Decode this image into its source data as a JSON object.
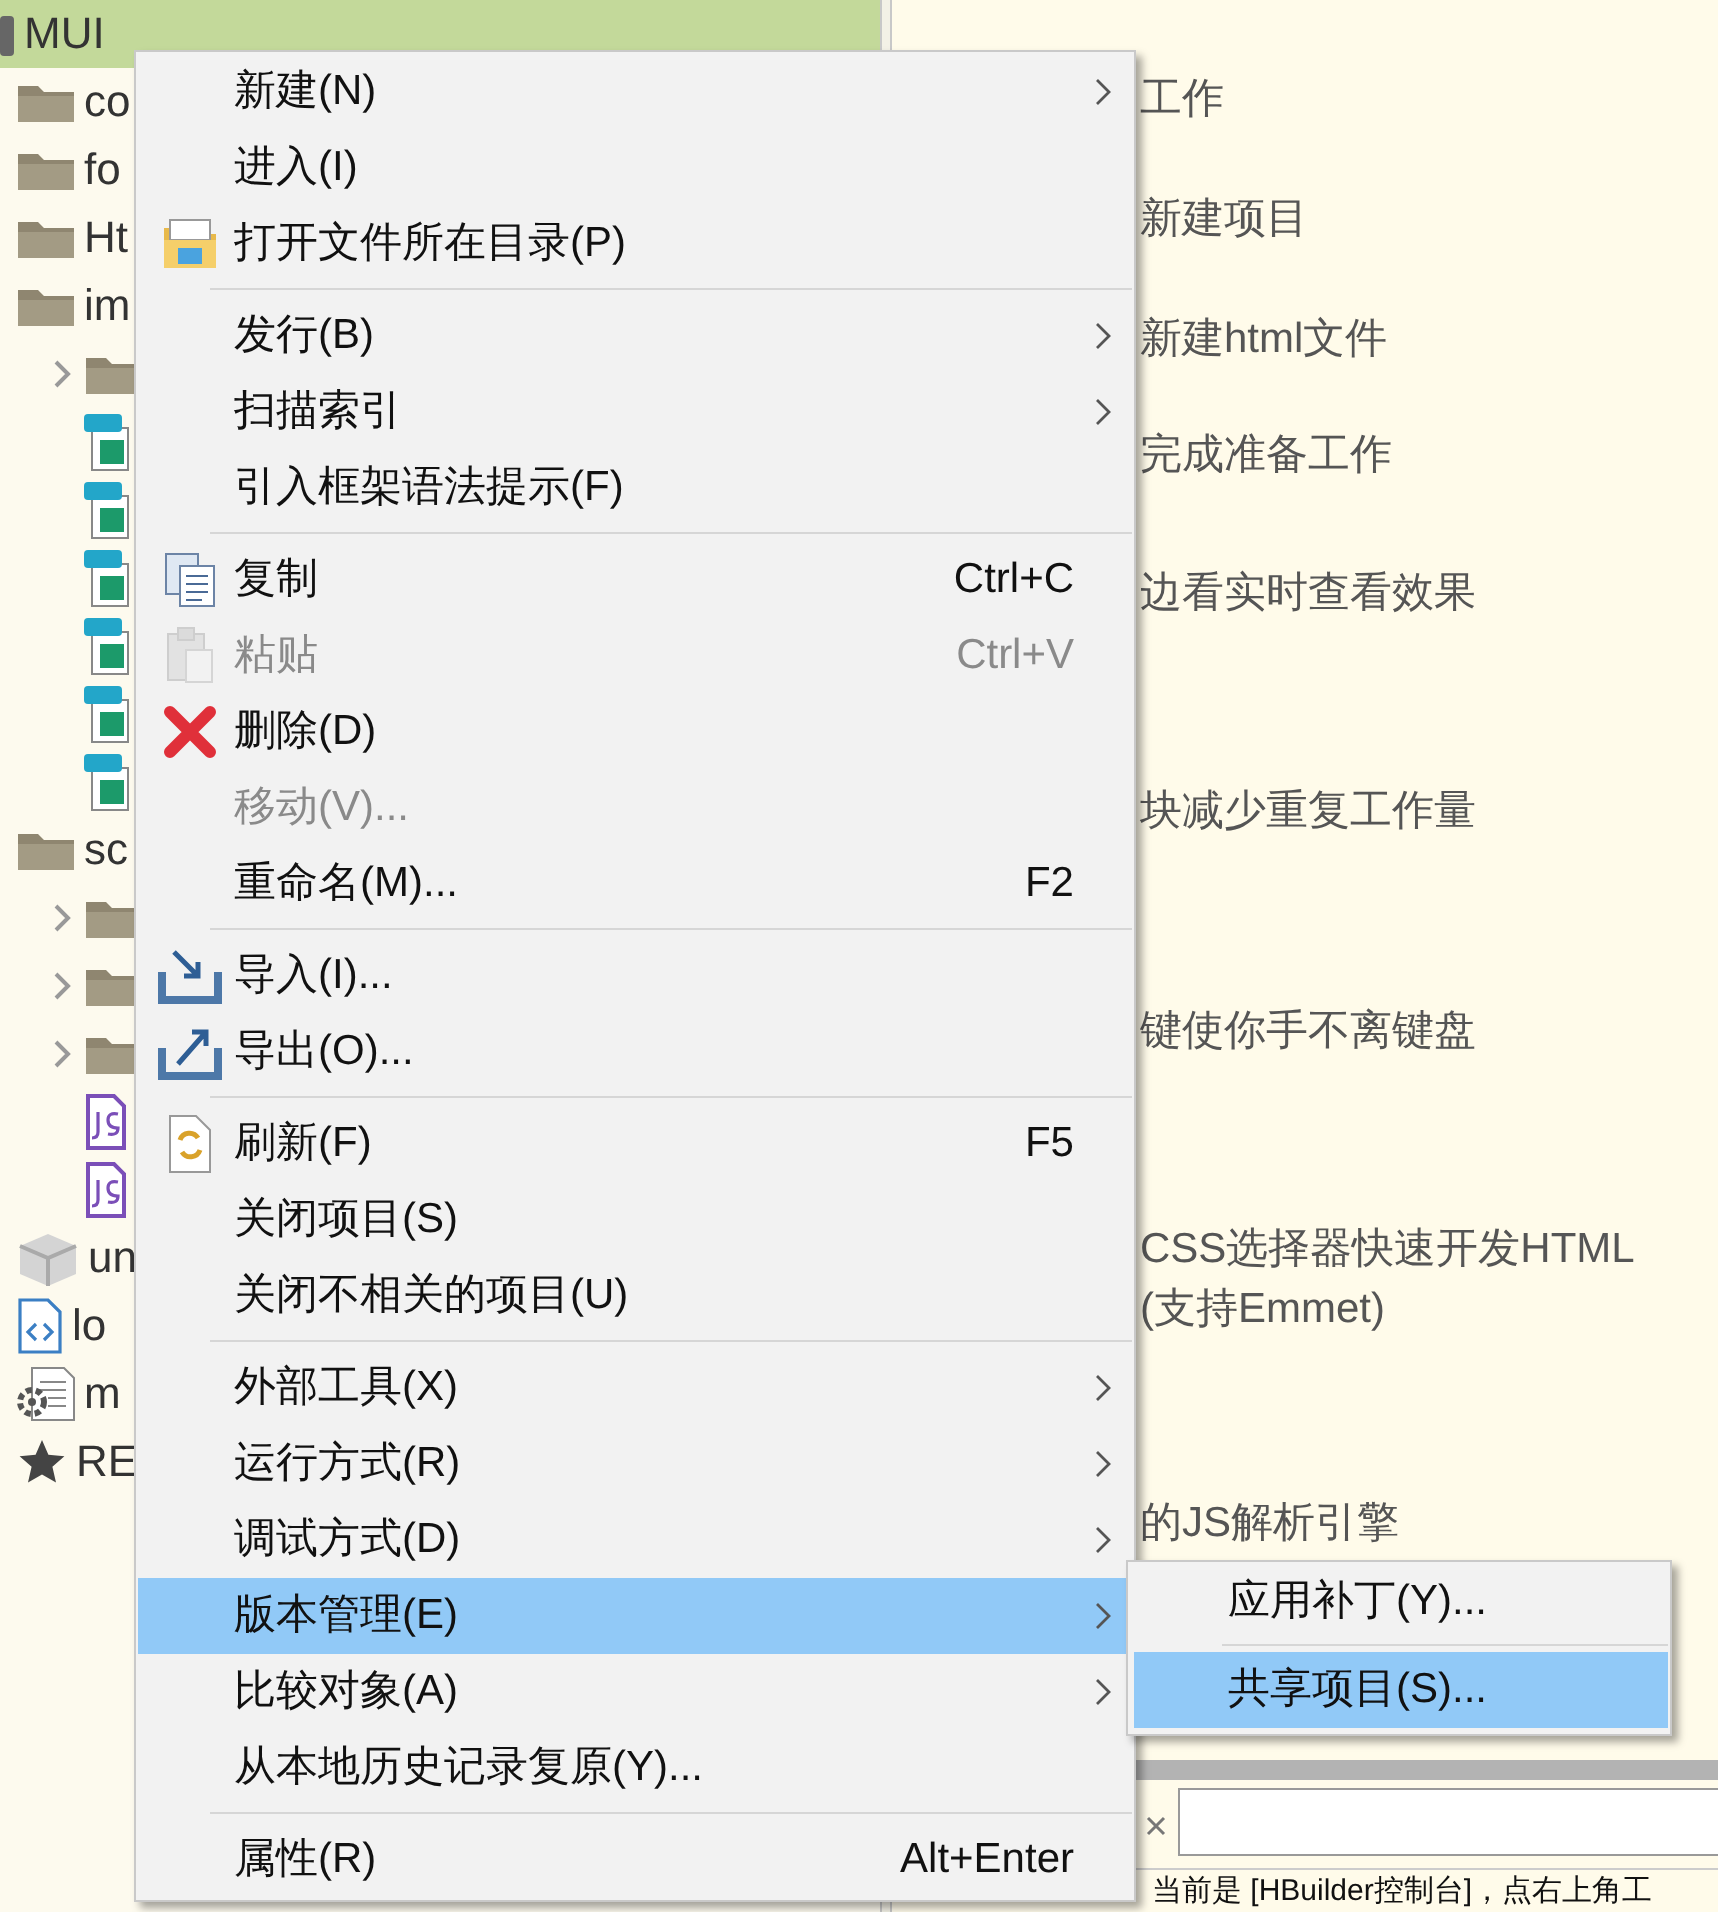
{
  "tree": {
    "label": "MUI",
    "kind": "project",
    "selected": true,
    "children": [
      {
        "label": "co",
        "kind": "folder",
        "selected": false
      },
      {
        "label": "fo",
        "kind": "folder",
        "selected": false
      },
      {
        "label": "Ht",
        "kind": "folder",
        "selected": false
      },
      {
        "label": "im",
        "kind": "folder",
        "selected": false,
        "children": [
          {
            "kind": "folder",
            "expandable": true,
            "selected": false
          },
          {
            "kind": "png",
            "selected": false
          },
          {
            "kind": "png",
            "selected": false
          },
          {
            "kind": "png",
            "selected": false
          },
          {
            "kind": "png",
            "selected": false
          },
          {
            "kind": "png",
            "selected": false
          },
          {
            "kind": "png",
            "selected": false
          }
        ]
      },
      {
        "label": "sc",
        "kind": "folder",
        "selected": false,
        "children": [
          {
            "kind": "folder",
            "expandable": true,
            "selected": false
          },
          {
            "kind": "folder",
            "expandable": true,
            "selected": false
          },
          {
            "kind": "folder",
            "expandable": true,
            "selected": false
          },
          {
            "kind": "js",
            "selected": false
          },
          {
            "kind": "js",
            "selected": false
          }
        ]
      },
      {
        "label": "un",
        "kind": "package",
        "selected": false
      },
      {
        "label": "lo",
        "kind": "html",
        "selected": false
      },
      {
        "label": "m",
        "kind": "config",
        "selected": false
      },
      {
        "label": "RE",
        "kind": "star",
        "selected": false
      }
    ]
  },
  "article": {
    "lines": [
      "工作",
      "新建项目",
      "新建html文件",
      "完成准备工作",
      "边看实时查看效果",
      "块减少重复工作量",
      "键使你手不离键盘",
      "CSS选择器快速开发HTML",
      "(支持Emmet)",
      "的JS解析引擎"
    ]
  },
  "console": {
    "text": "当前是 [HBuilder控制台]，点右上角工"
  },
  "menu": {
    "groups": [
      [
        {
          "label": "新建(N)",
          "submenu": true,
          "kind": "plain",
          "disabled": false,
          "selected": false
        },
        {
          "label": "进入(I)",
          "submenu": false,
          "kind": "plain",
          "disabled": false,
          "selected": false
        },
        {
          "label": "打开文件所在目录(P)",
          "submenu": false,
          "kind": "folder",
          "disabled": false,
          "selected": false
        }
      ],
      [
        {
          "label": "发行(B)",
          "submenu": true,
          "kind": "plain",
          "disabled": false,
          "selected": false
        },
        {
          "label": "扫描索引",
          "submenu": true,
          "kind": "plain",
          "disabled": false,
          "selected": false
        },
        {
          "label": "引入框架语法提示(F)",
          "submenu": false,
          "kind": "plain",
          "disabled": false,
          "selected": false
        }
      ],
      [
        {
          "label": "复制",
          "shortcut": "Ctrl+C",
          "submenu": false,
          "kind": "copy",
          "disabled": false,
          "selected": false
        },
        {
          "label": "粘贴",
          "shortcut": "Ctrl+V",
          "submenu": false,
          "kind": "paste",
          "disabled": true,
          "selected": false
        },
        {
          "label": "删除(D)",
          "submenu": false,
          "kind": "delete",
          "disabled": false,
          "selected": false
        },
        {
          "label": "移动(V)...",
          "submenu": false,
          "kind": "plain",
          "disabled": true,
          "selected": false
        },
        {
          "label": "重命名(M)...",
          "shortcut": "F2",
          "submenu": false,
          "kind": "plain",
          "disabled": false,
          "selected": false
        }
      ],
      [
        {
          "label": "导入(I)...",
          "submenu": false,
          "kind": "import",
          "disabled": false,
          "selected": false
        },
        {
          "label": "导出(O)...",
          "submenu": false,
          "kind": "export",
          "disabled": false,
          "selected": false
        }
      ],
      [
        {
          "label": "刷新(F)",
          "shortcut": "F5",
          "submenu": false,
          "kind": "refresh",
          "disabled": false,
          "selected": false
        },
        {
          "label": "关闭项目(S)",
          "submenu": false,
          "kind": "plain",
          "disabled": false,
          "selected": false
        },
        {
          "label": "关闭不相关的项目(U)",
          "submenu": false,
          "kind": "plain",
          "disabled": false,
          "selected": false
        }
      ],
      [
        {
          "label": "外部工具(X)",
          "submenu": true,
          "kind": "plain",
          "disabled": false,
          "selected": false
        },
        {
          "label": "运行方式(R)",
          "submenu": true,
          "kind": "plain",
          "disabled": false,
          "selected": false
        },
        {
          "label": "调试方式(D)",
          "submenu": true,
          "kind": "plain",
          "disabled": false,
          "selected": false
        },
        {
          "label": "版本管理(E)",
          "submenu": true,
          "kind": "plain",
          "disabled": false,
          "selected": true
        },
        {
          "label": "比较对象(A)",
          "submenu": true,
          "kind": "plain",
          "disabled": false,
          "selected": false
        },
        {
          "label": "从本地历史记录复原(Y)...",
          "submenu": false,
          "kind": "plain",
          "disabled": false,
          "selected": false
        }
      ],
      [
        {
          "label": "属性(R)",
          "shortcut": "Alt+Enter",
          "submenu": false,
          "kind": "plain",
          "disabled": false,
          "selected": false
        }
      ]
    ]
  },
  "submenu": {
    "groups": [
      [
        {
          "label": "应用补丁(Y)...",
          "selected": false
        }
      ],
      [
        {
          "label": "共享项目(S)...",
          "selected": true
        }
      ]
    ]
  }
}
